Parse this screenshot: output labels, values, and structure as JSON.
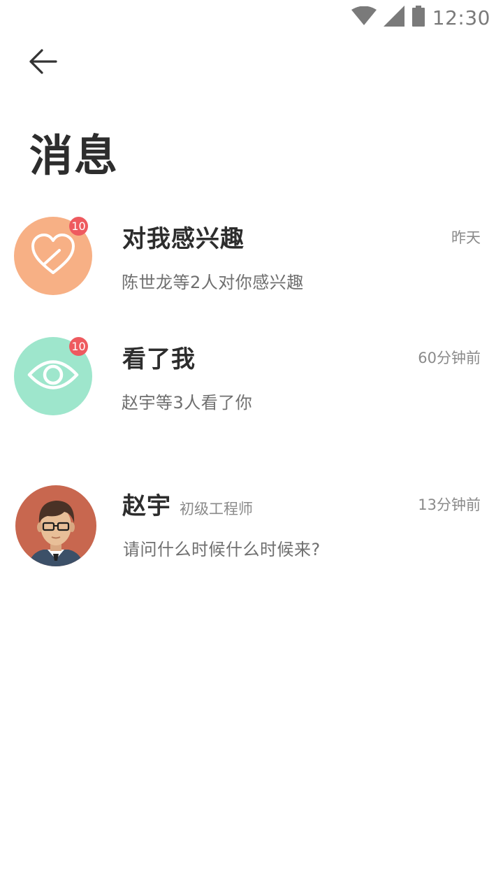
{
  "status_bar": {
    "time": "12:30",
    "icons": [
      "wifi-icon",
      "signal-icon",
      "battery-icon"
    ]
  },
  "header": {
    "back_icon": "arrow-left-icon",
    "title": "消息"
  },
  "messages": [
    {
      "title": "对我感兴趣",
      "time": "昨天",
      "description": "陈世龙等2人对你感兴趣",
      "badge": "10",
      "icon": "heart-icon",
      "color": "#f7b085"
    },
    {
      "title": "看了我",
      "time": "60分钟前",
      "description": "赵宇等3人看了你",
      "badge": "10",
      "icon": "eye-icon",
      "color": "#9ee6cc"
    },
    {
      "title": "赵宇",
      "subtitle": "初级工程师",
      "time": "13分钟前",
      "description": "请问什么时候什么时候来?",
      "icon": "user-avatar",
      "color": "#c8674f"
    }
  ],
  "colors": {
    "badge": "#ee5a5f",
    "text_primary": "#2d2d2d",
    "text_secondary": "#8a8a8a"
  }
}
